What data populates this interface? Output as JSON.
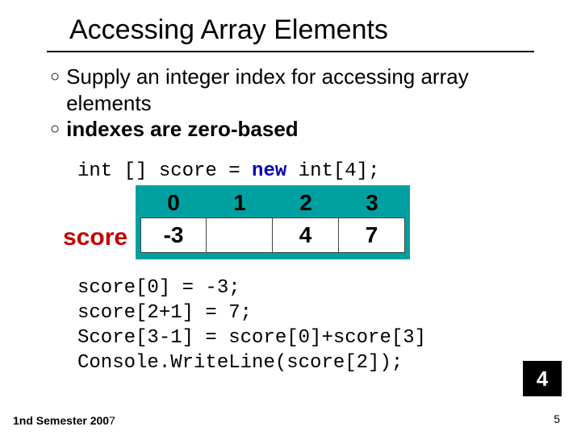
{
  "title": "Accessing Array Elements",
  "bullets": {
    "b1": "Supply an integer index for accessing array elements",
    "b2": "indexes are zero-based"
  },
  "decl": {
    "p1": "int [] score = ",
    "kw": "new",
    "p2": " int[4];"
  },
  "array": {
    "label": "score",
    "indices": [
      "0",
      "1",
      "2",
      "3"
    ],
    "values": [
      "-3",
      "",
      "4",
      "7"
    ]
  },
  "code": {
    "l1": "score[0] = -3;",
    "l2": "score[2+1] = 7;",
    "l3": "Score[3-1] = score[0]+score[3]",
    "l4": "Console.WriteLine(score[2]);"
  },
  "footer": {
    "p1": "1",
    "p2": "nd",
    "p3": " Semester 200",
    "p4": "7"
  },
  "badge": "4",
  "slide_num": "5"
}
